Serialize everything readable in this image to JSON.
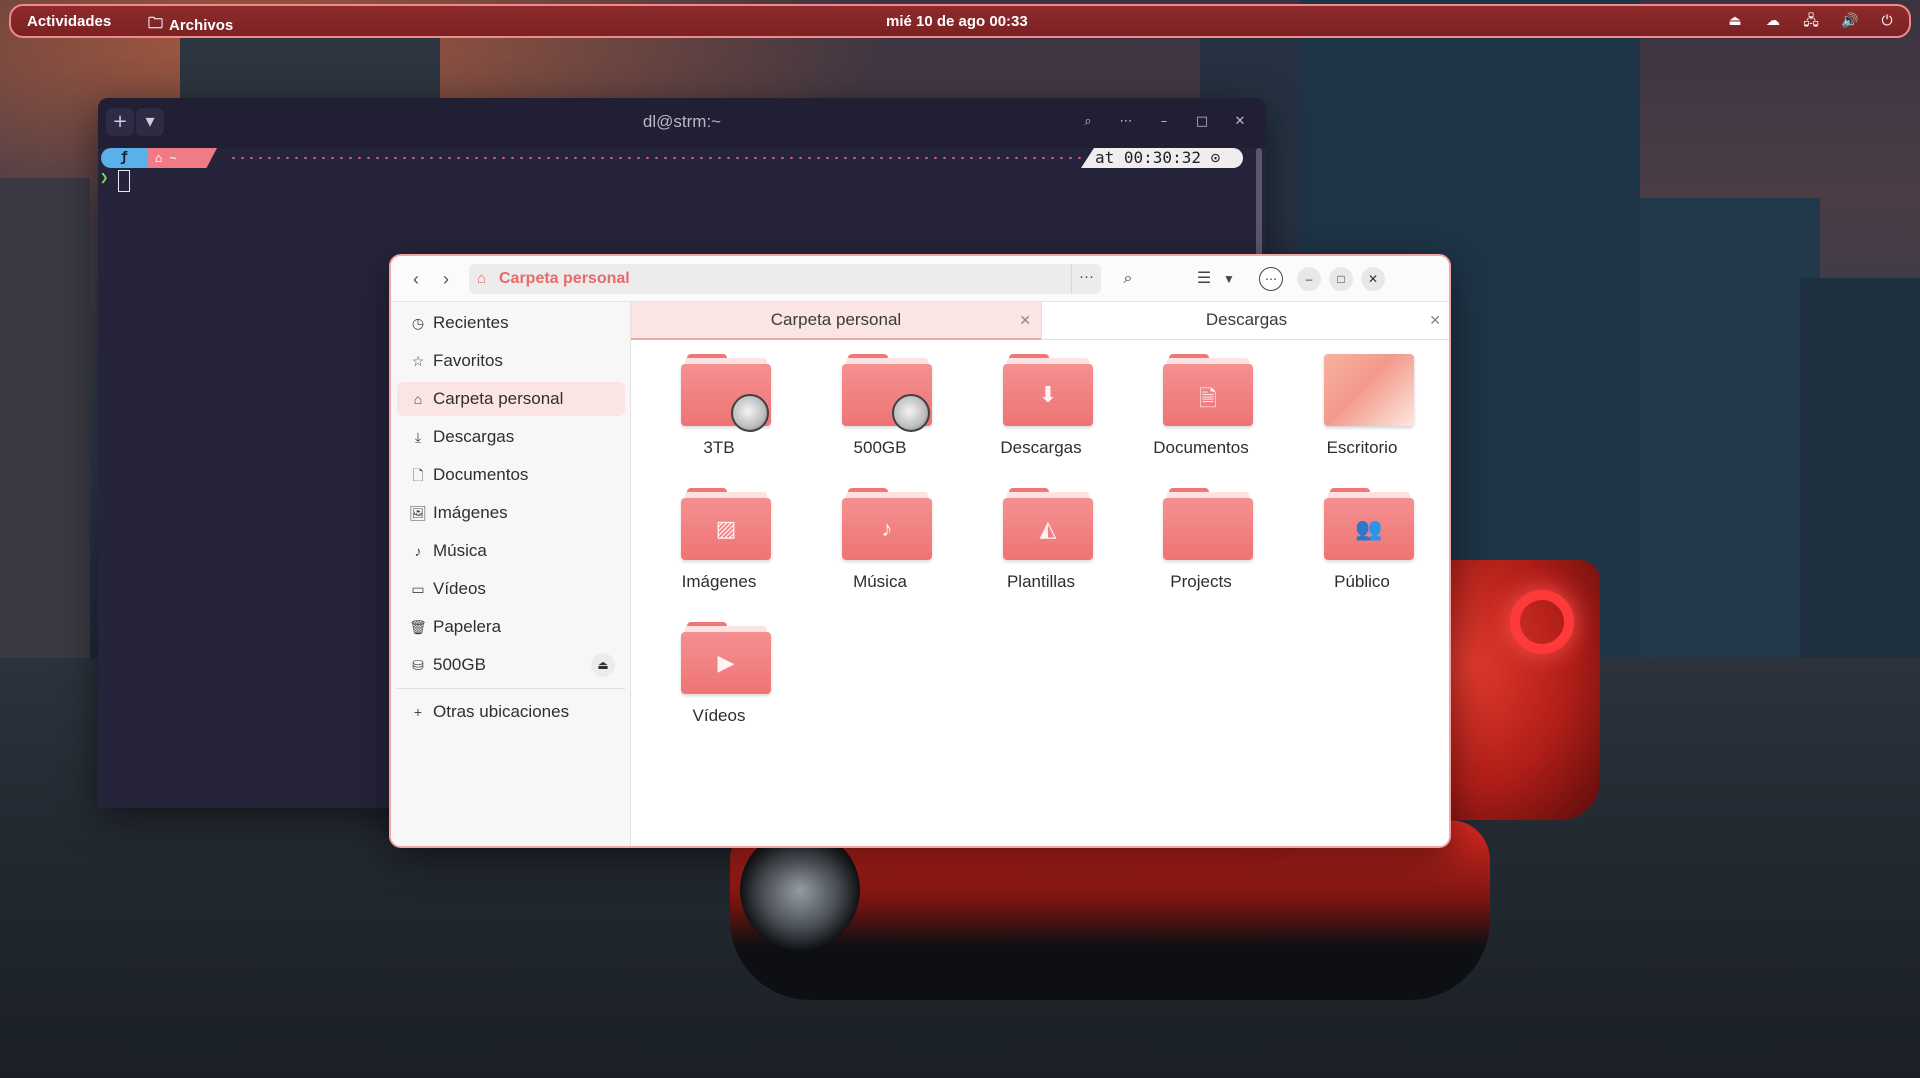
{
  "topbar": {
    "activities": "Actividades",
    "app_name": "Archivos",
    "clock": "mié 10 de ago  00:33",
    "tray": [
      {
        "name": "eject-icon",
        "glyph": "⏏"
      },
      {
        "name": "app-indicator-icon",
        "glyph": "☁"
      },
      {
        "name": "network-icon",
        "glyph": "🖧"
      },
      {
        "name": "volume-icon",
        "glyph": "🔊"
      },
      {
        "name": "power-icon",
        "glyph": "⏻"
      }
    ]
  },
  "terminal": {
    "title": "dl@strm:~",
    "new_tab": "+",
    "tab_menu": "▾",
    "prompt_os": "ƒ",
    "prompt_dir": "~",
    "prompt_time": "at 00:30:32 ⊙",
    "cursor_prompt": "❯"
  },
  "files": {
    "path": "Carpeta personal",
    "sidebar": [
      {
        "name": "recent",
        "label": "Recientes",
        "icon": "◷"
      },
      {
        "name": "starred",
        "label": "Favoritos",
        "icon": "☆"
      },
      {
        "name": "home",
        "label": "Carpeta personal",
        "icon": "⌂",
        "active": true
      },
      {
        "name": "downloads",
        "label": "Descargas",
        "icon": "⤓"
      },
      {
        "name": "documents",
        "label": "Documentos",
        "icon": "🗋"
      },
      {
        "name": "pictures",
        "label": "Imágenes",
        "icon": "🖼"
      },
      {
        "name": "music",
        "label": "Música",
        "icon": "♪"
      },
      {
        "name": "videos",
        "label": "Vídeos",
        "icon": "▭"
      },
      {
        "name": "trash",
        "label": "Papelera",
        "icon": "🗑"
      },
      {
        "name": "drive-500gb",
        "label": "500GB",
        "icon": "⛁",
        "eject": true
      }
    ],
    "other_locations": {
      "label": "Otras ubicaciones",
      "icon": "+"
    },
    "tabs": [
      {
        "label": "Carpeta personal",
        "active": true
      },
      {
        "label": "Descargas",
        "active": false
      }
    ],
    "items": [
      {
        "label": "3TB",
        "kind": "drive"
      },
      {
        "label": "500GB",
        "kind": "drive"
      },
      {
        "label": "Descargas",
        "kind": "folder",
        "emblem": "⬇"
      },
      {
        "label": "Documentos",
        "kind": "folder",
        "emblem": "🗎"
      },
      {
        "label": "Escritorio",
        "kind": "desktop"
      },
      {
        "label": "Imágenes",
        "kind": "folder",
        "emblem": "▨"
      },
      {
        "label": "Música",
        "kind": "folder",
        "emblem": "♪"
      },
      {
        "label": "Plantillas",
        "kind": "folder",
        "emblem": "◭"
      },
      {
        "label": "Projects",
        "kind": "folder",
        "emblem": ""
      },
      {
        "label": "Público",
        "kind": "folder",
        "emblem": "👥"
      },
      {
        "label": "Vídeos",
        "kind": "folder",
        "emblem": "▶"
      }
    ]
  },
  "colors": {
    "accent": "#ef7474",
    "topbar": "#8e2a2b",
    "terminal_bg": "#26243a"
  }
}
